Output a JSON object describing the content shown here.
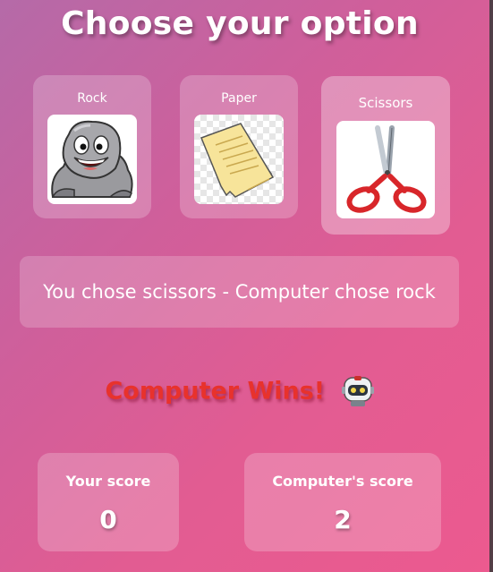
{
  "title": "Choose your option",
  "choices": [
    {
      "label": "Rock",
      "icon": "rock-icon"
    },
    {
      "label": "Paper",
      "icon": "paper-icon"
    },
    {
      "label": "Scissors",
      "icon": "scissors-icon",
      "selected": true
    }
  ],
  "result": "You chose scissors - Computer chose rock",
  "winner": {
    "text": "Computer Wins!",
    "icon": "robot-icon",
    "color": "#e8322c"
  },
  "scores": {
    "player": {
      "label": "Your score",
      "value": "0"
    },
    "computer": {
      "label": "Computer's score",
      "value": "2"
    }
  }
}
